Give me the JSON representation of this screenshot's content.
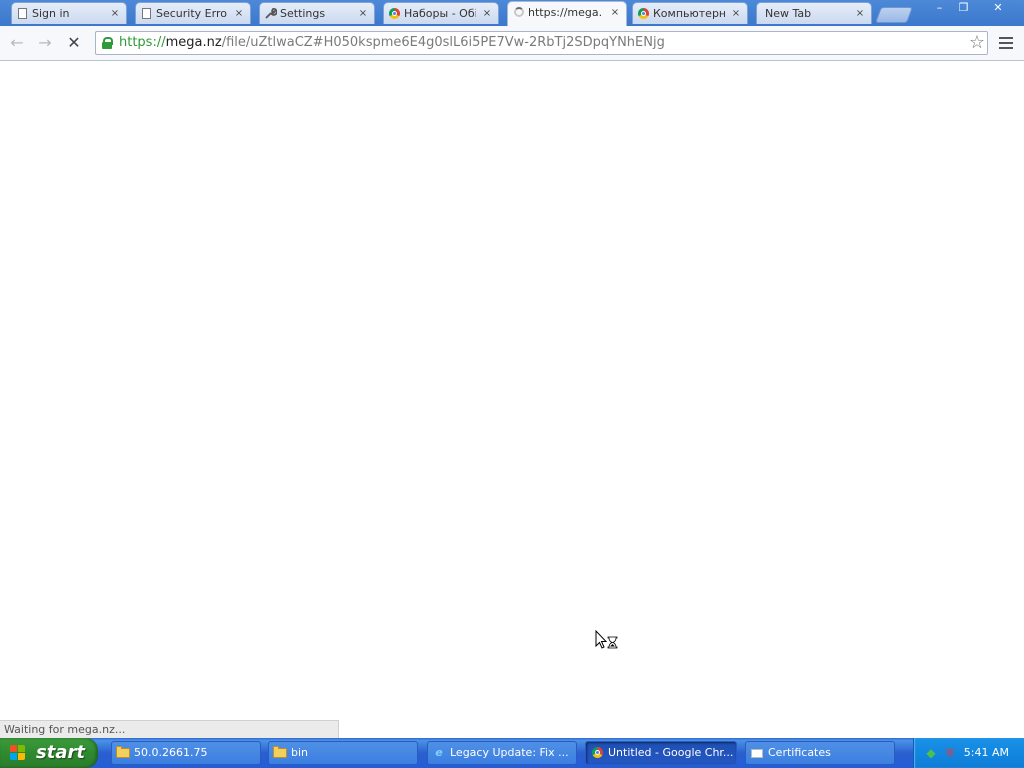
{
  "browser": {
    "tabs": [
      {
        "label": "Sign in",
        "icon": "page-icon",
        "active": false
      },
      {
        "label": "Security Error",
        "icon": "page-icon",
        "active": false
      },
      {
        "label": "Settings",
        "icon": "wrench-icon",
        "active": false
      },
      {
        "label": "Наборы - Обі",
        "icon": "chrome-icon",
        "active": false
      },
      {
        "label": "https://mega.",
        "icon": "loading-spinner-icon",
        "active": true
      },
      {
        "label": "Компьютерні",
        "icon": "chrome-icon",
        "active": false
      },
      {
        "label": "New Tab",
        "icon": "none",
        "active": false
      }
    ],
    "tab_close_glyph": "×",
    "window_controls": {
      "minimize": "–",
      "maximize": "❐",
      "close": "✕"
    },
    "toolbar": {
      "back_glyph": "←",
      "forward_glyph": "→",
      "stop_glyph": "✕",
      "url_scheme": "https://",
      "url_host": "mega.nz",
      "url_rest": "/file/uZtlwaCZ#H050kspme6E4g0slL6i5PE7Vw-2RbTj2SDpqYNhENjg",
      "star_glyph": "☆"
    },
    "status_text": "Waiting for mega.nz..."
  },
  "taskbar": {
    "start_label": "start",
    "tasks": [
      {
        "label": "50.0.2661.75",
        "icon": "folder-icon",
        "active": false
      },
      {
        "label": "bin",
        "icon": "folder-icon",
        "active": false
      },
      {
        "label": "Legacy Update: Fix ...",
        "icon": "ie-icon",
        "active": false
      },
      {
        "label": "Untitled - Google Chr...",
        "icon": "chrome-icon",
        "active": true
      },
      {
        "label": "Certificates",
        "icon": "certificate-icon",
        "active": false
      }
    ],
    "clock": "5:41 AM"
  },
  "colors": {
    "titlebar": "#3b78cc",
    "secure_green": "#2f9a37",
    "taskbar_blue": "#245dd7",
    "start_green": "#2f8a2f"
  }
}
